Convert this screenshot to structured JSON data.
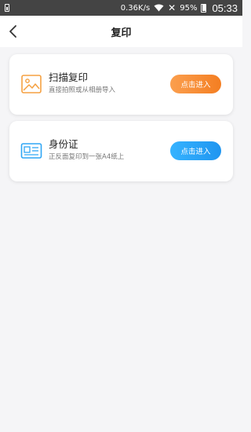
{
  "status_bar": {
    "network_speed": "0.36K/s",
    "battery_percent": "95%",
    "time": "05:33"
  },
  "header": {
    "title": "复印"
  },
  "cards": [
    {
      "title": "扫描复印",
      "subtitle": "直接拍照或从相册导入",
      "button_label": "点击进入",
      "icon": "image-icon",
      "accent_color": "#f5a142"
    },
    {
      "title": "身份证",
      "subtitle": "正反面复印到一张A4纸上",
      "button_label": "点击进入",
      "icon": "id-card-icon",
      "accent_color": "#2fa6f5"
    }
  ]
}
